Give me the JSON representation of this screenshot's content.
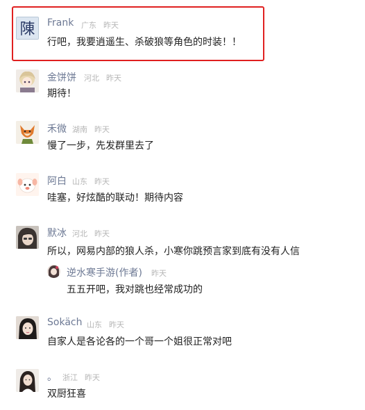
{
  "comments": [
    {
      "user": "Frank",
      "region": "广东",
      "time": "昨天",
      "text": "行吧，我要逍遥生、杀破狼等角色的时装！！",
      "avatar_icon": "chen-character-avatar-icon",
      "highlighted": true
    },
    {
      "user": "金饼饼",
      "region": "河北",
      "time": "昨天",
      "text": "期待！",
      "avatar_icon": "anime-girl-avatar-icon"
    },
    {
      "user": "禾微",
      "region": "湖南",
      "time": "昨天",
      "text": "慢了一步，先发群里去了",
      "avatar_icon": "fox-avatar-icon"
    },
    {
      "user": "阿白",
      "region": "山东",
      "time": "昨天",
      "text": "哇塞，好炫酷的联动！期待内容",
      "avatar_icon": "white-dog-avatar-icon"
    },
    {
      "user": "默冰",
      "region": "河北",
      "time": "昨天",
      "text": "所以，网易内部的狼人杀，小寒你跳预言家到底有没有人信",
      "avatar_icon": "dark-hair-avatar-icon",
      "reply": {
        "user": "逆水寒手游(作者)",
        "time": "昨天",
        "text": "五五开吧，我对跳也经常成功的",
        "avatar_icon": "author-avatar-icon"
      }
    },
    {
      "user": "Sokäch",
      "region": "山东",
      "time": "昨天",
      "text": "自家人是各论各的一个哥一个姐很正常对吧",
      "avatar_icon": "girl-portrait-avatar-icon"
    },
    {
      "user": "。",
      "region": "浙江",
      "time": "昨天",
      "text": "双厨狂喜",
      "avatar_icon": "long-hair-avatar-icon"
    }
  ],
  "colors": {
    "name": "#6d7994",
    "text": "#222222",
    "meta": "#b6b6b6",
    "highlight_border": "#e02020"
  }
}
